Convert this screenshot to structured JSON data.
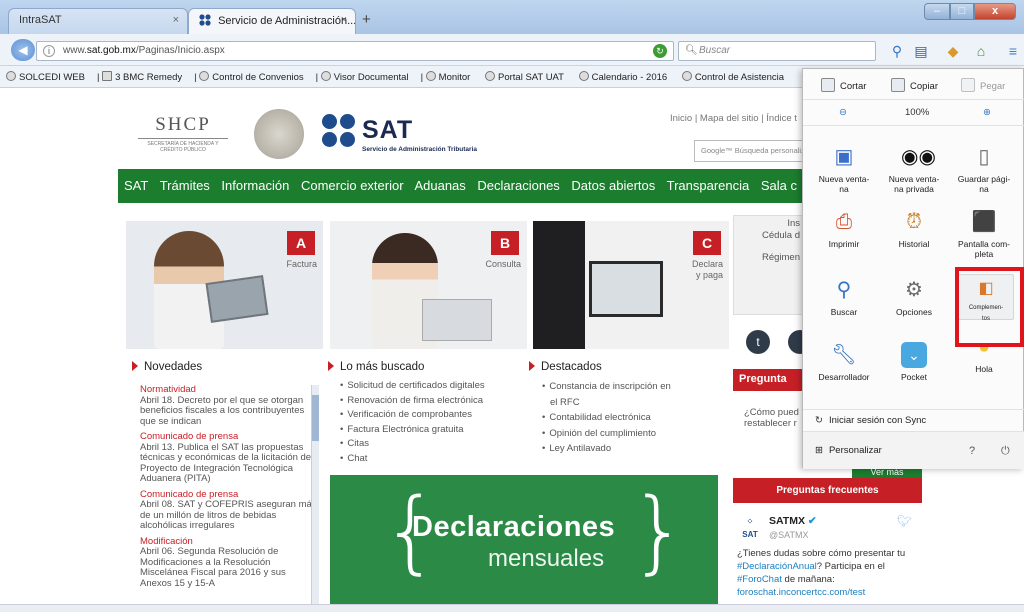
{
  "browser": {
    "tabs": [
      {
        "label": "IntraSAT",
        "active": false
      },
      {
        "label": "Servicio de Administración...",
        "active": true
      }
    ],
    "new_tab": "+",
    "tab_close": "×",
    "window_buttons": {
      "minimize": "–",
      "maximize": "□",
      "close": "x"
    },
    "url_prefix": "www.",
    "url_domain": "sat.gob.mx",
    "url_path": "/Paginas/Inicio.aspx",
    "search_placeholder": "Buscar",
    "bookmarks": [
      "SOLCEDI WEB",
      "3 BMC Remedy",
      "Control de Convenios",
      "Visor Documental",
      "Monitor",
      "Portal SAT UAT",
      "Calendario - 2016",
      "Control de Asistencia"
    ]
  },
  "header": {
    "links": "Inicio | Mapa del sitio | Índice t",
    "shcp": "SHCP",
    "shcp_sub": "SECRETARÍA DE HACIENDA Y CRÉDITO PÚBLICO",
    "sat": "SAT",
    "sat_sub": "Servicio de Administración Tributaria",
    "google_search": "Google™ Búsqueda personalizada"
  },
  "main_nav": [
    "SAT",
    "Trámites",
    "Información",
    "Comercio exterior",
    "Aduanas",
    "Declaraciones",
    "Datos abiertos",
    "Transparencia",
    "Sala c"
  ],
  "promos": [
    {
      "letter": "A",
      "label": "Factura"
    },
    {
      "letter": "B",
      "label": "Consulta"
    },
    {
      "letter": "C",
      "label_line1": "Declara",
      "label_line2": "y paga"
    }
  ],
  "novedades": {
    "title": "Novedades",
    "items": [
      {
        "title": "Normatividad",
        "text": "Abril 18. Decreto por el que se otorgan beneficios fiscales a los contribuyentes que se indican"
      },
      {
        "title": "Comunicado de prensa",
        "text": "Abril 13. Publica el SAT las propuestas técnicas y económicas de la licitación del Proyecto de Integración Tecnológica Aduanera (PITA)"
      },
      {
        "title": "Comunicado de prensa",
        "text": "Abril 08. SAT y COFEPRIS aseguran más de un millón de litros de bebidas alcohólicas irregulares"
      },
      {
        "title": "Modificación",
        "text": "Abril 06. Segunda Resolución de Modificaciones a la Resolución Miscelánea Fiscal para 2016 y sus Anexos 15 y 15-A"
      }
    ]
  },
  "mas_buscado": {
    "title": "Lo más buscado",
    "items": [
      "Solicitud de certificados digitales",
      "Renovación de firma electrónica",
      "Verificación de comprobantes",
      "Factura Electrónica gratuita",
      "Citas",
      "Chat"
    ]
  },
  "destacados": {
    "title": "Destacados",
    "items": [
      "Constancia de inscripción en",
      "el RFC",
      "Contabilidad electrónica",
      "Opinión del cumplimiento",
      "Ley Antilavado"
    ]
  },
  "banner": {
    "title": "Declaraciones",
    "subtitle": "mensuales"
  },
  "right_col": {
    "box_lines": [
      "Ins",
      "Cédula d",
      "",
      "Régimen"
    ],
    "pregunta": "Pregunta",
    "pregunta_text_1": "¿Cómo pued",
    "pregunta_text_2": "restablecer r",
    "ver_mas": "Ver más",
    "preguntas_frecuentes": "Preguntas frecuentes",
    "tweet_name": "SATMX",
    "tweet_handle": "@SATMX",
    "tweet_text_1": "¿Tienes dudas sobre cómo presentar tu ",
    "tweet_tag_1": "#DeclaraciónAnual",
    "tweet_text_2": "? Participa en el ",
    "tweet_tag_2": "#ForoChat",
    "tweet_text_3": " de mañana:",
    "tweet_link": "foroschat.inconcertcc.com/test"
  },
  "menu": {
    "cut": "Cortar",
    "copy": "Copiar",
    "paste": "Pegar",
    "zoom_out": "⊖",
    "zoom": "100%",
    "zoom_in": "⊕",
    "items": [
      {
        "label": "Nueva venta-\nna",
        "icon": "new-window-icon"
      },
      {
        "label": "Nueva venta-\nna privada",
        "icon": "private-window-icon"
      },
      {
        "label": "Guardar pági-\nna",
        "icon": "save-page-icon"
      },
      {
        "label": "Imprimir",
        "icon": "print-icon"
      },
      {
        "label": "Historial",
        "icon": "history-icon"
      },
      {
        "label": "Pantalla com-\npleta",
        "icon": "fullscreen-icon"
      },
      {
        "label": "Buscar",
        "icon": "search-icon"
      },
      {
        "label": "Opciones",
        "icon": "options-icon"
      },
      {
        "label": "Complemen-\ntos",
        "icon": "addons-icon"
      },
      {
        "label": "Desarrollador",
        "icon": "developer-icon"
      },
      {
        "label": "Pocket",
        "icon": "pocket-icon"
      },
      {
        "label": "Hola",
        "icon": "hello-icon"
      }
    ],
    "sync": "Iniciar sesión con Sync",
    "customize": "Personalizar"
  },
  "colors": {
    "sat_green": "#1c7d2f",
    "sat_red": "#c62026",
    "highlight": "#e0141b"
  }
}
